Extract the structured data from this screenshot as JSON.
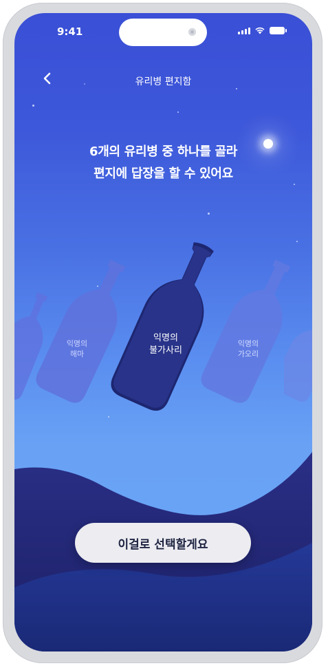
{
  "status_bar": {
    "time": "9:41"
  },
  "header": {
    "title": "유리병 편지함"
  },
  "headline": {
    "line1": "6개의 유리병 중 하나를 골라",
    "line2": "편지에 답장을 할 수 있어요"
  },
  "bottles": [
    {
      "line1": "익명의",
      "line2": "해마"
    },
    {
      "line1": "익명의",
      "line2": "불가사리",
      "selected": true
    },
    {
      "line1": "익명의",
      "line2": "가오리"
    }
  ],
  "cta": {
    "label": "이걸로 선택할게요"
  },
  "colors": {
    "sky_top": "#3a4fd6",
    "sky_bottom": "#6aa6f5",
    "hill_dark": "#1f2a6b",
    "selected_bottle": "#253080"
  }
}
